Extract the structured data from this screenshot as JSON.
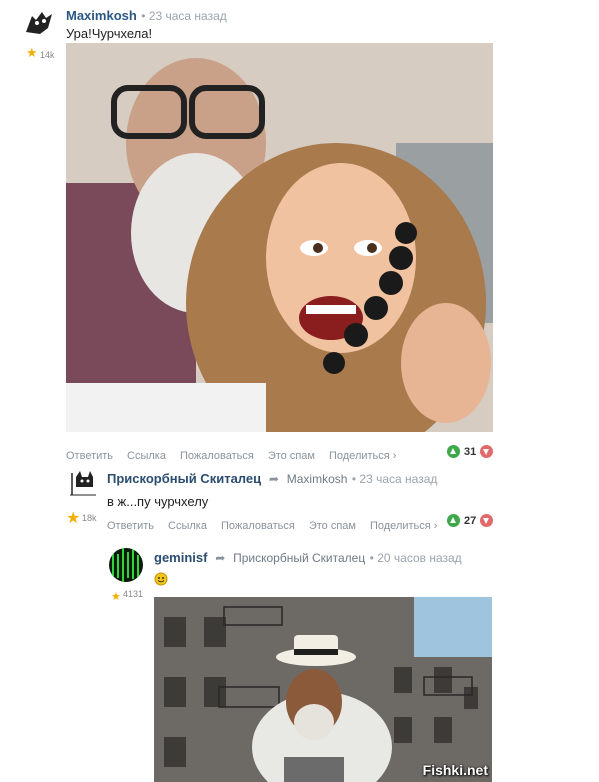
{
  "comment1": {
    "username": "Maximkosh",
    "time": "• 23 часа назад",
    "rating": "14k",
    "text": "Ура!Чурчхела!",
    "actions": [
      "Ответить",
      "Ссылка",
      "Пожаловаться",
      "Это спам",
      "Поделиться ›"
    ],
    "votes": "31"
  },
  "comment2": {
    "username": "Прискорбный Скиталец",
    "reply_to": "Maximkosh",
    "time": "• 23 часа назад",
    "rating": "18k",
    "text": "в ж...пу чурчхелу",
    "actions": [
      "Ответить",
      "Ссылка",
      "Пожаловаться",
      "Это спам",
      "Поделиться ›"
    ],
    "votes": "27"
  },
  "comment3": {
    "username": "geminisf",
    "reply_to": "Прискорбный Скиталец",
    "time": "• 20 часов назад",
    "rating": "4131",
    "emoji": "smiley-emoji"
  },
  "watermark": "Fishki.net",
  "colors": {
    "link": "#2a5885",
    "upvote": "#3ea84a",
    "downvote": "#e06a6a"
  }
}
